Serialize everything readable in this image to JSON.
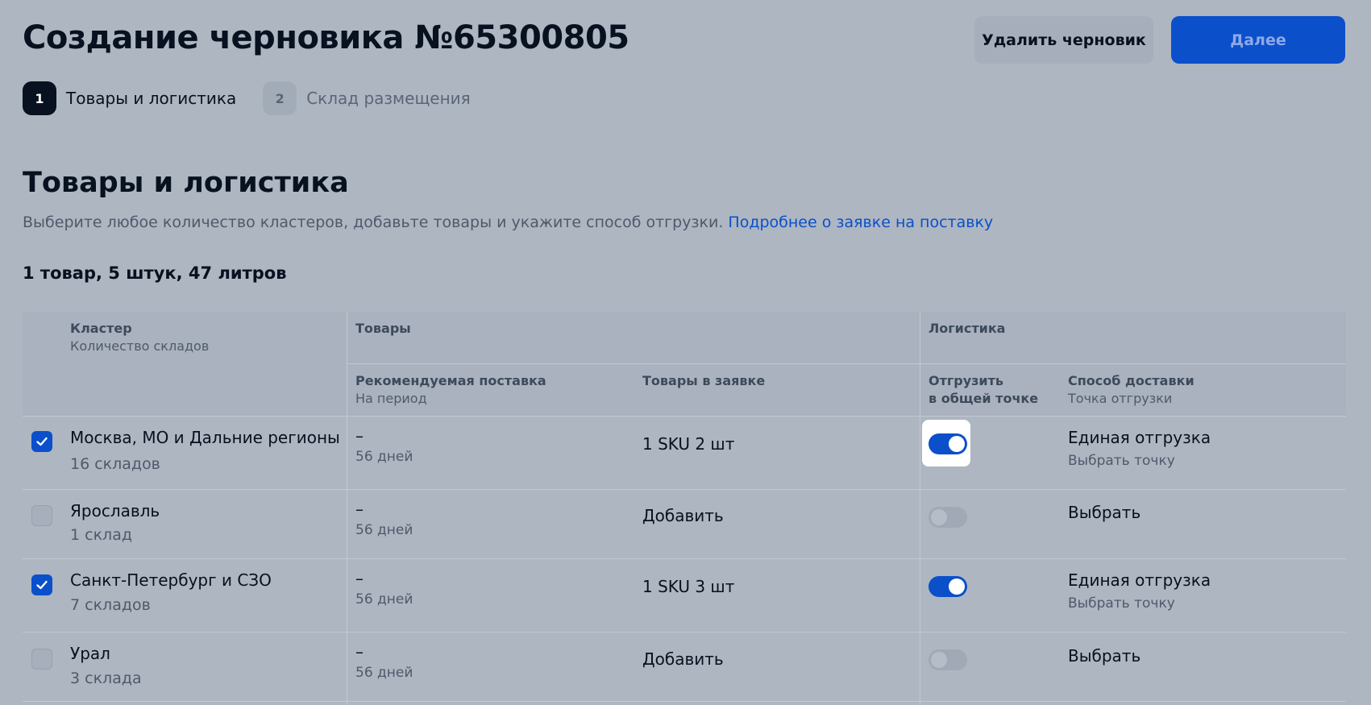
{
  "header": {
    "title": "Создание черновика №65300805",
    "delete_label": "Удалить черновик",
    "next_label": "Далее"
  },
  "steps": [
    {
      "num": "1",
      "label": "Товары и логистика",
      "active": true
    },
    {
      "num": "2",
      "label": "Склад размещения",
      "active": false
    }
  ],
  "section": {
    "title": "Товары и логистика",
    "description": "Выберите любое количество кластеров, добавьте товары и укажите способ отгрузки.",
    "link": "Подробнее о заявке на поставку",
    "summary": "1 товар, 5 штук, 47 литров"
  },
  "table": {
    "headers": {
      "cluster": "Кластер",
      "cluster_sub": "Количество складов",
      "goods": "Товары",
      "logistics": "Логистика",
      "recommended": "Рекомендуемая поставка",
      "recommended_sub": "На период",
      "in_request": "Товары в заявке",
      "ship_common_1": "Отгрузить",
      "ship_common_2": "в общей точке",
      "delivery": "Способ доставки",
      "delivery_sub": "Точка отгрузки"
    },
    "rows": [
      {
        "checked": true,
        "name": "Москва, МО и Дальние регионы",
        "warehouses": "16 складов",
        "rec_dash": "–",
        "rec_period": "56 дней",
        "goods": "1 SKU 2 шт",
        "toggle_on": true,
        "toggle_focus": true,
        "delivery": "Единая отгрузка",
        "delivery_sub": "Выбрать точку"
      },
      {
        "checked": false,
        "name": "Ярославль",
        "warehouses": "1 склад",
        "rec_dash": "–",
        "rec_period": "56 дней",
        "goods": "Добавить",
        "toggle_on": false,
        "toggle_focus": false,
        "delivery": "Выбрать",
        "delivery_sub": ""
      },
      {
        "checked": true,
        "name": "Санкт-Петербург и СЗО",
        "warehouses": "7 складов",
        "rec_dash": "–",
        "rec_period": "56 дней",
        "goods": "1 SKU 3 шт",
        "toggle_on": true,
        "toggle_focus": false,
        "delivery": "Единая отгрузка",
        "delivery_sub": "Выбрать точку"
      },
      {
        "checked": false,
        "name": "Урал",
        "warehouses": "3 склада",
        "rec_dash": "–",
        "rec_period": "56 дней",
        "goods": "Добавить",
        "toggle_on": false,
        "toggle_focus": false,
        "delivery": "Выбрать",
        "delivery_sub": ""
      }
    ]
  },
  "colors": {
    "accent": "#0b4fcb",
    "background": "#aeb6c1",
    "text_primary": "#07111f",
    "text_secondary": "#4e5a6b"
  },
  "icons": {
    "checkbox_checked": "check-icon"
  }
}
